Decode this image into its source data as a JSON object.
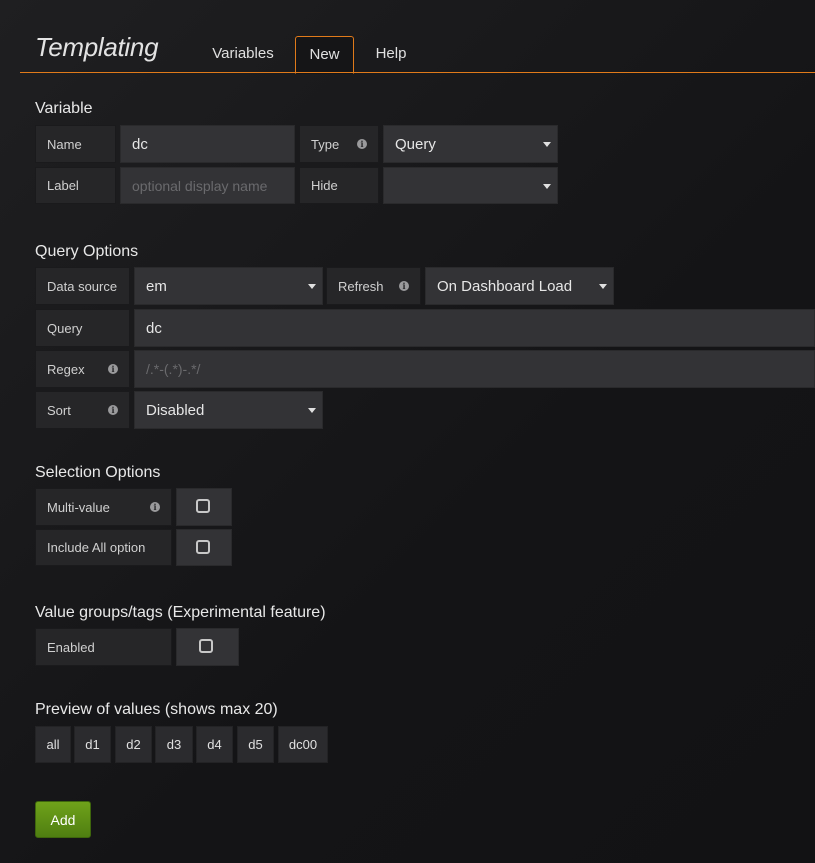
{
  "header": {
    "title": "Templating",
    "tabs": [
      {
        "label": "Variables"
      },
      {
        "label": "New"
      },
      {
        "label": "Help"
      }
    ]
  },
  "variable": {
    "section_title": "Variable",
    "name_label": "Name",
    "name_value": "dc",
    "type_label": "Type",
    "type_value": "Query",
    "label_label": "Label",
    "label_placeholder": "optional display name",
    "hide_label": "Hide",
    "hide_value": ""
  },
  "query_options": {
    "section_title": "Query Options",
    "datasource_label": "Data source",
    "datasource_value": "em",
    "refresh_label": "Refresh",
    "refresh_value": "On Dashboard Load",
    "query_label": "Query",
    "query_value": "dc",
    "regex_label": "Regex",
    "regex_placeholder": "/.*-(.*)-.*/",
    "sort_label": "Sort",
    "sort_value": "Disabled"
  },
  "selection_options": {
    "section_title": "Selection Options",
    "multi_value_label": "Multi-value",
    "multi_value_checked": false,
    "include_all_label": "Include All option",
    "include_all_checked": false
  },
  "value_groups": {
    "section_title": "Value groups/tags (Experimental feature)",
    "enabled_label": "Enabled",
    "enabled_checked": false
  },
  "preview": {
    "section_title": "Preview of values (shows max 20)",
    "values": [
      "all",
      "d1",
      "d2",
      "d3",
      "d4",
      "d5",
      "dc00"
    ]
  },
  "actions": {
    "add_label": "Add"
  },
  "colors": {
    "accent": "#e07a1a",
    "add_button": "#5e9416",
    "background": "#161618"
  }
}
